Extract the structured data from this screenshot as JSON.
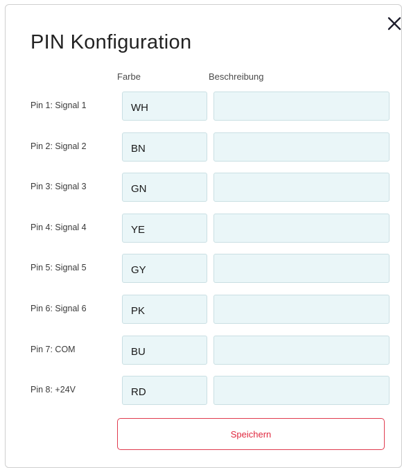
{
  "dialog": {
    "title": "PIN Konfiguration",
    "close_icon": "close-icon"
  },
  "columns": {
    "color": "Farbe",
    "description": "Beschreibung"
  },
  "pins": [
    {
      "label": "Pin 1: Signal 1",
      "color": "WH",
      "description": ""
    },
    {
      "label": "Pin 2: Signal 2",
      "color": "BN",
      "description": ""
    },
    {
      "label": "Pin 3: Signal 3",
      "color": "GN",
      "description": ""
    },
    {
      "label": "Pin 4: Signal 4",
      "color": "YE",
      "description": ""
    },
    {
      "label": "Pin 5: Signal 5",
      "color": "GY",
      "description": ""
    },
    {
      "label": "Pin 6: Signal 6",
      "color": "PK",
      "description": ""
    },
    {
      "label": "Pin 7: COM",
      "color": "BU",
      "description": ""
    },
    {
      "label": "Pin 8: +24V",
      "color": "RD",
      "description": ""
    }
  ],
  "actions": {
    "save_label": "Speichern"
  },
  "theme": {
    "field_background": "#eaf6f8",
    "accent": "#e0283f"
  }
}
